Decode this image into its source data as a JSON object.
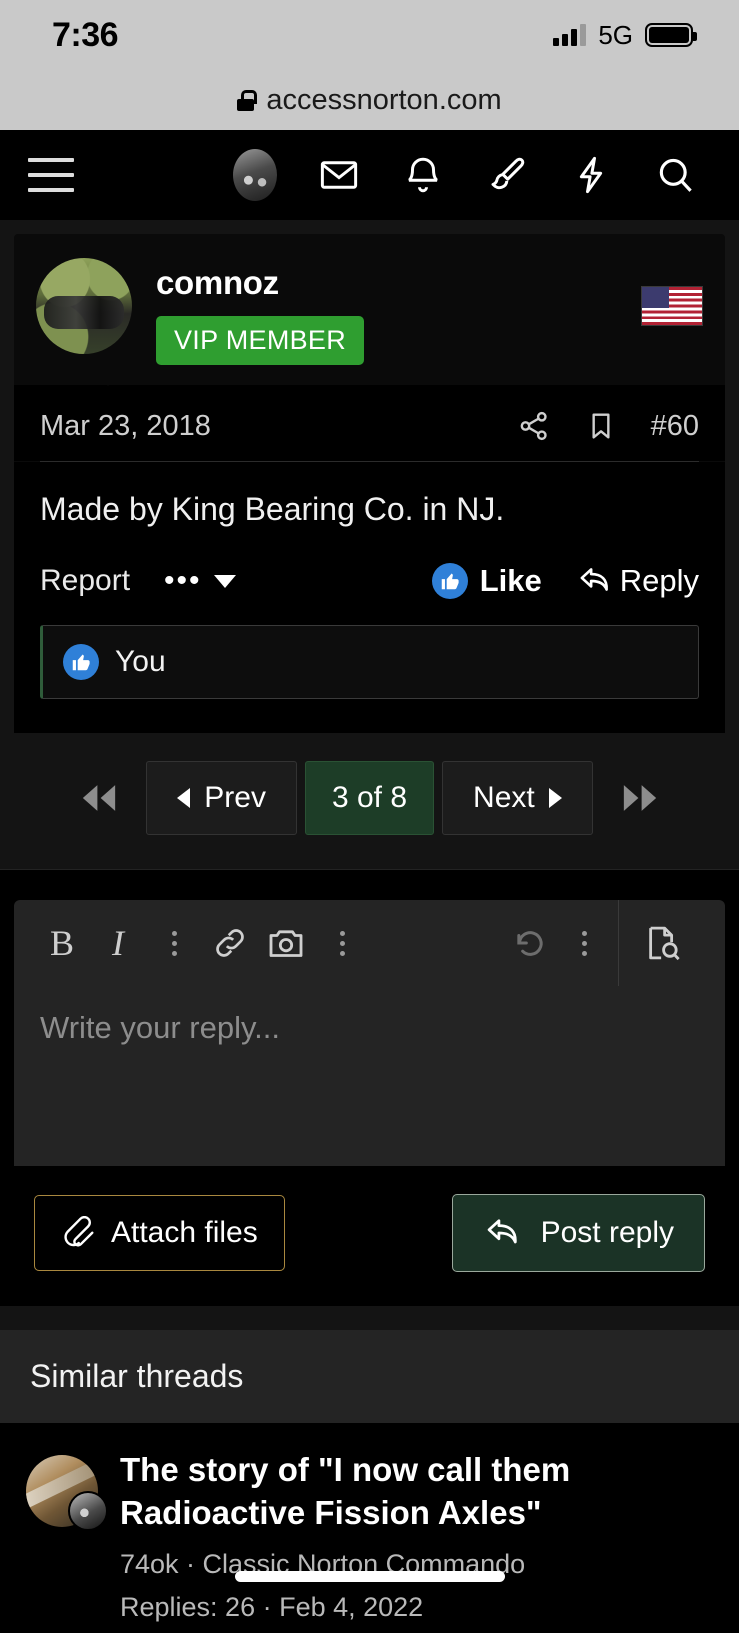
{
  "status_bar": {
    "time": "7:36",
    "network": "5G",
    "signal_bars_filled": 3,
    "signal_bars_total": 4,
    "battery_full": true
  },
  "browser": {
    "url": "accessnorton.com",
    "secure_icon": "lock-icon"
  },
  "nav": {
    "menu_icon": "hamburger-icon",
    "items": [
      {
        "name": "user-avatar",
        "icon": "avatar-icon"
      },
      {
        "name": "inbox",
        "icon": "envelope-icon"
      },
      {
        "name": "alerts",
        "icon": "bell-icon"
      },
      {
        "name": "theme",
        "icon": "paintbrush-icon"
      },
      {
        "name": "whats-new",
        "icon": "lightning-icon"
      },
      {
        "name": "search",
        "icon": "search-icon"
      }
    ]
  },
  "post": {
    "username": "comnoz",
    "badge": "VIP MEMBER",
    "badge_color": "#2f9e30",
    "flag": "us-flag-icon",
    "date": "Mar 23, 2018",
    "post_number": "#60",
    "share_icon": "share-icon",
    "bookmark_icon": "bookmark-icon",
    "body": "Made by King Bearing Co. in NJ.",
    "report_label": "Report",
    "more_icon": "ellipsis-icon",
    "caret_icon": "chevron-down-icon",
    "like_label": "Like",
    "like_icon": "thumbs-up-icon",
    "like_color": "#2f80d8",
    "reply_label": "Reply",
    "reply_icon": "reply-arrow-icon",
    "reactions": {
      "icon": "thumbs-up-icon",
      "text": "You"
    }
  },
  "pagination": {
    "first_icon": "double-chevron-left-icon",
    "prev_label": "Prev",
    "current": "3 of 8",
    "next_label": "Next",
    "last_icon": "double-chevron-right-icon",
    "current_bg": "#1d3d27"
  },
  "editor": {
    "toolbar": [
      {
        "name": "bold-button",
        "glyph": "B"
      },
      {
        "name": "italic-button",
        "glyph": "I"
      },
      {
        "name": "more-text-options",
        "glyph": "vertical-dots-icon"
      },
      {
        "name": "insert-link-button",
        "glyph": "link-icon"
      },
      {
        "name": "insert-image-button",
        "glyph": "camera-icon"
      },
      {
        "name": "more-insert-options",
        "glyph": "vertical-dots-icon"
      },
      {
        "name": "undo-button",
        "glyph": "undo-icon"
      },
      {
        "name": "more-history-options",
        "glyph": "vertical-dots-icon"
      },
      {
        "name": "preview-button",
        "glyph": "document-search-icon"
      }
    ],
    "placeholder": "Write your reply...",
    "value": "",
    "attach_label": "Attach files",
    "attach_icon": "paperclip-icon",
    "attach_border_color": "#a9883f",
    "post_label": "Post reply",
    "post_icon": "reply-arrow-icon",
    "post_bg": "#1b3326"
  },
  "similar_threads": {
    "heading": "Similar threads",
    "items": [
      {
        "title": "The story of \"I now call them Radioactive Fission Axles\"",
        "author_forum": "74ok · Classic Norton Commando",
        "stats": "Replies: 26 · Feb 4, 2022",
        "thumb": "thread-thumbnail",
        "mini_thumb": "author-avatar"
      }
    ]
  }
}
